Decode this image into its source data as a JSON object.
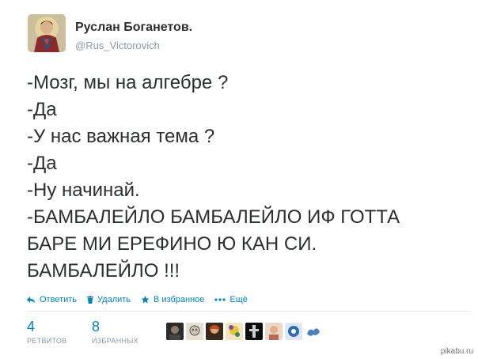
{
  "user": {
    "display_name": "Руслан Боганетов.",
    "handle": "@Rus_Victorovich"
  },
  "tweet": {
    "lines": [
      "-Мозг, мы на алгебре ?",
      "-Да",
      "-У нас важная тема ?",
      "-Да",
      "-Ну начинай.",
      "-БАМБАЛЕЙЛО БАМБАЛЕЙЛО ИФ ГОТТА",
      "БАРЕ МИ ЕРЕФИНО Ю КАН СИ.",
      "БАМБАЛЕЙЛО !!!"
    ]
  },
  "actions": {
    "reply": {
      "label": "Ответить",
      "icon": "reply-icon"
    },
    "delete": {
      "label": "Удалить",
      "icon": "trash-icon"
    },
    "favorite": {
      "label": "В избранное",
      "icon": "star-icon"
    },
    "more": {
      "label": "Ещё",
      "icon": "more-dots-icon"
    }
  },
  "stats": {
    "retweets": {
      "count": "4",
      "label": "РЕТВИТОВ"
    },
    "favorites": {
      "count": "8",
      "label": "ИЗБРАННЫХ"
    }
  },
  "favoriters_count": 8,
  "watermark": "pikabu.ru",
  "colors": {
    "link": "#0084b4",
    "text": "#292f33",
    "muted": "#8899a6"
  }
}
